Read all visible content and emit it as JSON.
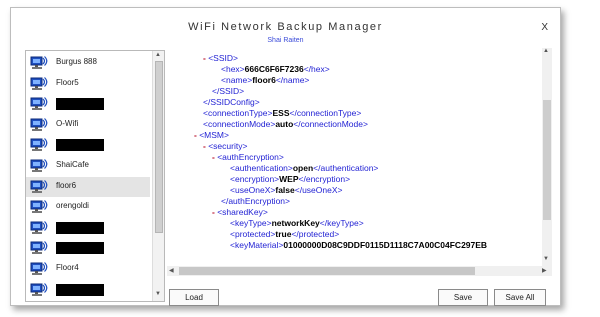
{
  "window": {
    "title": "WiFi Network Backup Manager",
    "subtitle": "Shai Raiten",
    "close_label": "X"
  },
  "networks": [
    {
      "label": "Burgus 888",
      "redacted": false
    },
    {
      "label": "Floor5",
      "redacted": false
    },
    {
      "label": "",
      "redacted": true
    },
    {
      "label": "O-Wifi",
      "redacted": false
    },
    {
      "label": "",
      "redacted": true
    },
    {
      "label": "ShaiCafe",
      "redacted": false
    },
    {
      "label": "floor6",
      "redacted": false,
      "selected": true
    },
    {
      "label": "orengoldi",
      "redacted": false
    },
    {
      "label": "",
      "redacted": true
    },
    {
      "label": "",
      "redacted": true
    },
    {
      "label": "Floor4",
      "redacted": false
    },
    {
      "label": "",
      "redacted": true
    }
  ],
  "xml": {
    "l1": {
      "dash": "-",
      "open": "<SSID>"
    },
    "l2": {
      "open": "<hex>",
      "value": "666C6F6F7236",
      "close": "</hex>"
    },
    "l3": {
      "open": "<name>",
      "value": "floor6",
      "close": "</name>"
    },
    "l4": {
      "close": "</SSID>"
    },
    "l5": {
      "close": "</SSIDConfig>"
    },
    "l6": {
      "open": "<connectionType>",
      "value": "ESS",
      "close": "</connectionType>"
    },
    "l7": {
      "open": "<connectionMode>",
      "value": "auto",
      "close": "</connectionMode>"
    },
    "l8": {
      "dash": "-",
      "open": "<MSM>"
    },
    "l9": {
      "dash": "-",
      "open": "<security>"
    },
    "l10": {
      "dash": "-",
      "open": "<authEncryption>"
    },
    "l11": {
      "open": "<authentication>",
      "value": "open",
      "close": "</authentication>"
    },
    "l12": {
      "open": "<encryption>",
      "value": "WEP",
      "close": "</encryption>"
    },
    "l13": {
      "open": "<useOneX>",
      "value": "false",
      "close": "</useOneX>"
    },
    "l14": {
      "close": "</authEncryption>"
    },
    "l15": {
      "dash": "-",
      "open": "<sharedKey>"
    },
    "l16": {
      "open": "<keyType>",
      "value": "networkKey",
      "close": "</keyType>"
    },
    "l17": {
      "open": "<protected>",
      "value": "true",
      "close": "</protected>"
    },
    "l18": {
      "open": "<keyMaterial>",
      "value": "01000000D08C9DDF0115D1118C7A00C04FC297EB"
    }
  },
  "buttons": {
    "load": "Load",
    "save": "Save",
    "save_all": "Save All"
  }
}
